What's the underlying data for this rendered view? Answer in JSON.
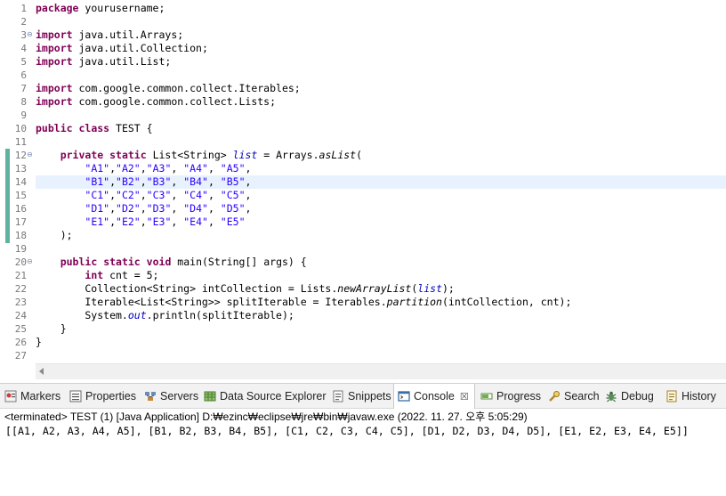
{
  "editor": {
    "highlight_line": "14",
    "lines": [
      {
        "n": "1",
        "fold": "",
        "tokens": [
          {
            "t": "package",
            "c": "kw"
          },
          {
            "t": " yourusername;",
            "c": ""
          }
        ]
      },
      {
        "n": "2",
        "fold": "",
        "tokens": []
      },
      {
        "n": "3",
        "fold": "⊖",
        "tokens": [
          {
            "t": "import",
            "c": "kw"
          },
          {
            "t": " java.util.Arrays;",
            "c": ""
          }
        ]
      },
      {
        "n": "4",
        "fold": "",
        "tokens": [
          {
            "t": "import",
            "c": "kw"
          },
          {
            "t": " java.util.Collection;",
            "c": ""
          }
        ]
      },
      {
        "n": "5",
        "fold": "",
        "tokens": [
          {
            "t": "import",
            "c": "kw"
          },
          {
            "t": " java.util.List;",
            "c": ""
          }
        ]
      },
      {
        "n": "6",
        "fold": "",
        "tokens": []
      },
      {
        "n": "7",
        "fold": "",
        "tokens": [
          {
            "t": "import",
            "c": "kw"
          },
          {
            "t": " com.google.common.collect.Iterables;",
            "c": ""
          }
        ]
      },
      {
        "n": "8",
        "fold": "",
        "tokens": [
          {
            "t": "import",
            "c": "kw"
          },
          {
            "t": " com.google.common.collect.Lists;",
            "c": ""
          }
        ]
      },
      {
        "n": "9",
        "fold": "",
        "tokens": []
      },
      {
        "n": "10",
        "fold": "",
        "tokens": [
          {
            "t": "public",
            "c": "kw"
          },
          {
            "t": " ",
            "c": ""
          },
          {
            "t": "class",
            "c": "kw"
          },
          {
            "t": " TEST {",
            "c": ""
          }
        ]
      },
      {
        "n": "11",
        "fold": "",
        "tokens": []
      },
      {
        "n": "12",
        "fold": "⊖",
        "tokens": [
          {
            "t": "    ",
            "c": ""
          },
          {
            "t": "private",
            "c": "kw"
          },
          {
            "t": " ",
            "c": ""
          },
          {
            "t": "static",
            "c": "kw"
          },
          {
            "t": " List<String> ",
            "c": ""
          },
          {
            "t": "list",
            "c": "fld"
          },
          {
            "t": " = Arrays.",
            "c": ""
          },
          {
            "t": "asList",
            "c": "ital"
          },
          {
            "t": "(",
            "c": ""
          }
        ]
      },
      {
        "n": "13",
        "fold": "",
        "tokens": [
          {
            "t": "        ",
            "c": ""
          },
          {
            "t": "\"A1\"",
            "c": "str"
          },
          {
            "t": ",",
            "c": ""
          },
          {
            "t": "\"A2\"",
            "c": "str"
          },
          {
            "t": ",",
            "c": ""
          },
          {
            "t": "\"A3\"",
            "c": "str"
          },
          {
            "t": ", ",
            "c": ""
          },
          {
            "t": "\"A4\"",
            "c": "str"
          },
          {
            "t": ", ",
            "c": ""
          },
          {
            "t": "\"A5\"",
            "c": "str"
          },
          {
            "t": ",",
            "c": ""
          }
        ]
      },
      {
        "n": "14",
        "fold": "",
        "tokens": [
          {
            "t": "        ",
            "c": ""
          },
          {
            "t": "\"B1\"",
            "c": "str"
          },
          {
            "t": ",",
            "c": ""
          },
          {
            "t": "\"B2\"",
            "c": "str"
          },
          {
            "t": ",",
            "c": ""
          },
          {
            "t": "\"B3\"",
            "c": "str"
          },
          {
            "t": ", ",
            "c": ""
          },
          {
            "t": "\"B4\"",
            "c": "str"
          },
          {
            "t": ", ",
            "c": ""
          },
          {
            "t": "\"B5\"",
            "c": "str"
          },
          {
            "t": ",",
            "c": ""
          }
        ]
      },
      {
        "n": "15",
        "fold": "",
        "tokens": [
          {
            "t": "        ",
            "c": ""
          },
          {
            "t": "\"C1\"",
            "c": "str"
          },
          {
            "t": ",",
            "c": ""
          },
          {
            "t": "\"C2\"",
            "c": "str"
          },
          {
            "t": ",",
            "c": ""
          },
          {
            "t": "\"C3\"",
            "c": "str"
          },
          {
            "t": ", ",
            "c": ""
          },
          {
            "t": "\"C4\"",
            "c": "str"
          },
          {
            "t": ", ",
            "c": ""
          },
          {
            "t": "\"C5\"",
            "c": "str"
          },
          {
            "t": ",",
            "c": ""
          }
        ]
      },
      {
        "n": "16",
        "fold": "",
        "tokens": [
          {
            "t": "        ",
            "c": ""
          },
          {
            "t": "\"D1\"",
            "c": "str"
          },
          {
            "t": ",",
            "c": ""
          },
          {
            "t": "\"D2\"",
            "c": "str"
          },
          {
            "t": ",",
            "c": ""
          },
          {
            "t": "\"D3\"",
            "c": "str"
          },
          {
            "t": ", ",
            "c": ""
          },
          {
            "t": "\"D4\"",
            "c": "str"
          },
          {
            "t": ", ",
            "c": ""
          },
          {
            "t": "\"D5\"",
            "c": "str"
          },
          {
            "t": ",",
            "c": ""
          }
        ]
      },
      {
        "n": "17",
        "fold": "",
        "tokens": [
          {
            "t": "        ",
            "c": ""
          },
          {
            "t": "\"E1\"",
            "c": "str"
          },
          {
            "t": ",",
            "c": ""
          },
          {
            "t": "\"E2\"",
            "c": "str"
          },
          {
            "t": ",",
            "c": ""
          },
          {
            "t": "\"E3\"",
            "c": "str"
          },
          {
            "t": ", ",
            "c": ""
          },
          {
            "t": "\"E4\"",
            "c": "str"
          },
          {
            "t": ", ",
            "c": ""
          },
          {
            "t": "\"E5\"",
            "c": "str"
          }
        ]
      },
      {
        "n": "18",
        "fold": "",
        "tokens": [
          {
            "t": "    );",
            "c": ""
          }
        ]
      },
      {
        "n": "19",
        "fold": "",
        "tokens": []
      },
      {
        "n": "20",
        "fold": "⊖",
        "tokens": [
          {
            "t": "    ",
            "c": ""
          },
          {
            "t": "public",
            "c": "kw"
          },
          {
            "t": " ",
            "c": ""
          },
          {
            "t": "static",
            "c": "kw"
          },
          {
            "t": " ",
            "c": ""
          },
          {
            "t": "void",
            "c": "kw"
          },
          {
            "t": " main(String[] args) {",
            "c": ""
          }
        ]
      },
      {
        "n": "21",
        "fold": "",
        "tokens": [
          {
            "t": "        ",
            "c": ""
          },
          {
            "t": "int",
            "c": "kw"
          },
          {
            "t": " cnt = 5;",
            "c": ""
          }
        ]
      },
      {
        "n": "22",
        "fold": "",
        "tokens": [
          {
            "t": "        Collection<String> intCollection = Lists.",
            "c": ""
          },
          {
            "t": "newArrayList",
            "c": "ital"
          },
          {
            "t": "(",
            "c": ""
          },
          {
            "t": "list",
            "c": "fld"
          },
          {
            "t": ");",
            "c": ""
          }
        ]
      },
      {
        "n": "23",
        "fold": "",
        "tokens": [
          {
            "t": "        Iterable<List<String>> splitIterable = Iterables.",
            "c": ""
          },
          {
            "t": "partition",
            "c": "ital"
          },
          {
            "t": "(intCollection, cnt);",
            "c": ""
          }
        ]
      },
      {
        "n": "24",
        "fold": "",
        "tokens": [
          {
            "t": "        System.",
            "c": ""
          },
          {
            "t": "out",
            "c": "fld"
          },
          {
            "t": ".println(splitIterable);",
            "c": ""
          }
        ]
      },
      {
        "n": "25",
        "fold": "",
        "tokens": [
          {
            "t": "    }",
            "c": ""
          }
        ]
      },
      {
        "n": "26",
        "fold": "",
        "tokens": [
          {
            "t": "}",
            "c": ""
          }
        ]
      },
      {
        "n": "27",
        "fold": "",
        "tokens": []
      }
    ]
  },
  "views": {
    "tabs": [
      {
        "label": "Markers",
        "icon": "markers-icon",
        "active": false
      },
      {
        "label": "Properties",
        "icon": "properties-icon",
        "active": false
      },
      {
        "label": "Servers",
        "icon": "servers-icon",
        "active": false
      },
      {
        "label": "Data Source Explorer",
        "icon": "data-source-icon",
        "active": false
      },
      {
        "label": "Snippets",
        "icon": "snippets-icon",
        "active": false
      },
      {
        "label": "Console",
        "icon": "console-icon",
        "active": true,
        "close": "☒"
      },
      {
        "label": "Progress",
        "icon": "progress-icon",
        "active": false
      },
      {
        "label": "Search",
        "icon": "search-icon",
        "active": false
      },
      {
        "label": "Debug",
        "icon": "debug-icon",
        "active": false
      },
      {
        "label": "History",
        "icon": "history-icon",
        "active": false
      }
    ]
  },
  "console": {
    "status": "<terminated> TEST (1) [Java Application] D:₩ezinc₩eclipse₩jre₩bin₩javaw.exe (2022. 11. 27. 오후 5:05:29)",
    "output": "[[A1, A2, A3, A4, A5], [B1, B2, B3, B4, B5], [C1, C2, C3, C4, C5], [D1, D2, D3, D4, D5], [E1, E2, E3, E4, E5]]"
  },
  "colors": {
    "keyword": "#7f0055",
    "string": "#2a00ff",
    "field": "#0000c0",
    "current_line": "#e8f2fe",
    "change_bar": "#5eb39e"
  }
}
